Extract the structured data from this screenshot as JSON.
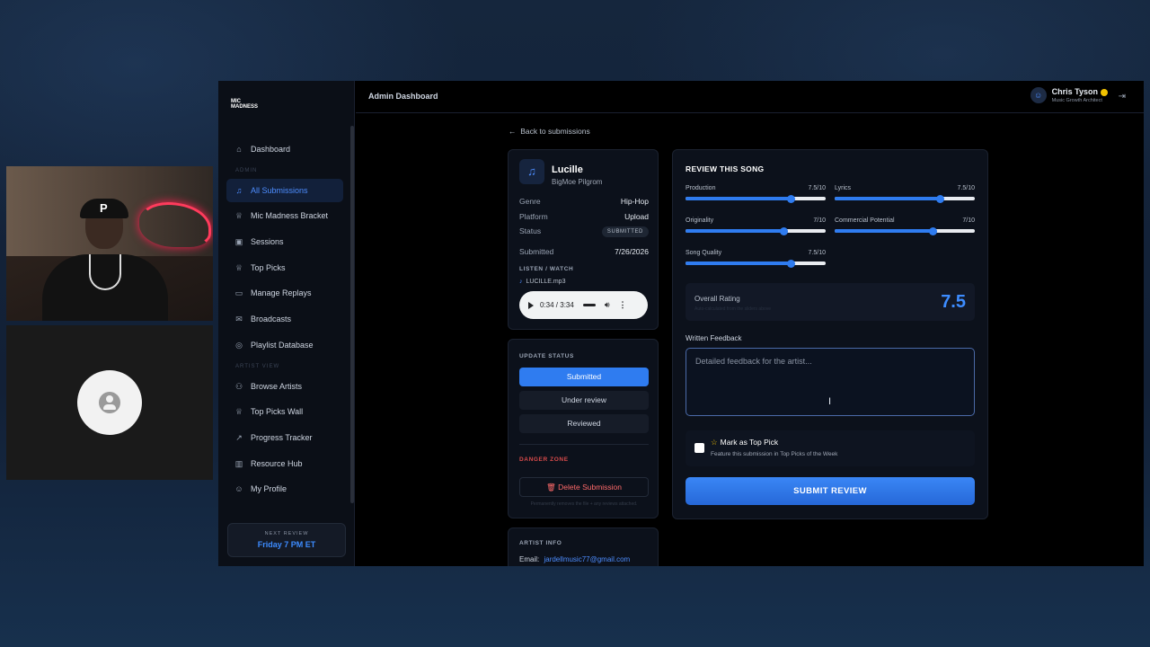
{
  "app": {
    "logo_line1": "MIC",
    "logo_line2": "MADNESS",
    "header_title": "Admin Dashboard"
  },
  "sidebar": {
    "items": [
      {
        "label": "Dashboard",
        "icon": "home-icon"
      },
      {
        "label": "All Submissions",
        "icon": "music-note-icon",
        "active": true
      },
      {
        "label": "Mic Madness Bracket",
        "icon": "trophy-icon"
      },
      {
        "label": "Sessions",
        "icon": "calendar-icon"
      },
      {
        "label": "Top Picks",
        "icon": "trophy-icon"
      },
      {
        "label": "Manage Replays",
        "icon": "video-icon"
      },
      {
        "label": "Broadcasts",
        "icon": "mail-icon"
      },
      {
        "label": "Playlist Database",
        "icon": "database-icon"
      },
      {
        "label": "Browse Artists",
        "icon": "users-icon"
      },
      {
        "label": "Top Picks Wall",
        "icon": "trophy-icon"
      },
      {
        "label": "Progress Tracker",
        "icon": "trend-icon"
      },
      {
        "label": "Resource Hub",
        "icon": "book-icon"
      },
      {
        "label": "My Profile",
        "icon": "user-icon"
      }
    ],
    "headings": {
      "admin": "ADMIN",
      "artist": "ARTIST VIEW"
    },
    "next_review_label": "NEXT REVIEW",
    "next_review_value": "Friday 7 PM ET"
  },
  "user": {
    "name": "Chris Tyson",
    "role": "Music Growth Architect"
  },
  "back_link": "Back to submissions",
  "song": {
    "title": "Lucille",
    "artist": "BigMoe Pilgrom",
    "genre_label": "Genre",
    "genre": "Hip-Hop",
    "platform_label": "Platform",
    "platform": "Upload",
    "status_label": "Status",
    "status": "SUBMITTED",
    "submitted_label": "Submitted",
    "submitted": "7/26/2026",
    "listen_label": "LISTEN / WATCH",
    "file": "LUCILLE.mp3",
    "player_time": "0:34 / 3:34"
  },
  "update_status": {
    "label": "UPDATE STATUS",
    "options": [
      "Submitted",
      "Under review",
      "Reviewed"
    ],
    "danger_label": "DANGER ZONE",
    "delete_label": "Delete Submission",
    "delete_note": "Permanently removes the file + any reviews attached."
  },
  "artist_info": {
    "label": "ARTIST INFO",
    "email_label": "Email:",
    "email": "jardellmusic77@gmail.com"
  },
  "review": {
    "title": "REVIEW THIS SONG",
    "sliders": [
      {
        "label": "Production",
        "value": 7.5,
        "display": "7.5/10"
      },
      {
        "label": "Lyrics",
        "value": 7.5,
        "display": "7.5/10"
      },
      {
        "label": "Originality",
        "value": 7,
        "display": "7/10"
      },
      {
        "label": "Commercial Potential",
        "value": 7,
        "display": "7/10"
      },
      {
        "label": "Song Quality",
        "value": 7.5,
        "display": "7.5/10"
      }
    ],
    "overall_label": "Overall Rating",
    "overall_sub": "Auto-calculated from the sliders above",
    "overall_value": "7.5",
    "feedback_label": "Written Feedback",
    "feedback_placeholder": "Detailed feedback for the artist...",
    "top_pick_title": "Mark as Top Pick",
    "top_pick_sub": "Feature this submission in Top Picks of the Week",
    "submit_label": "SUBMIT REVIEW"
  }
}
